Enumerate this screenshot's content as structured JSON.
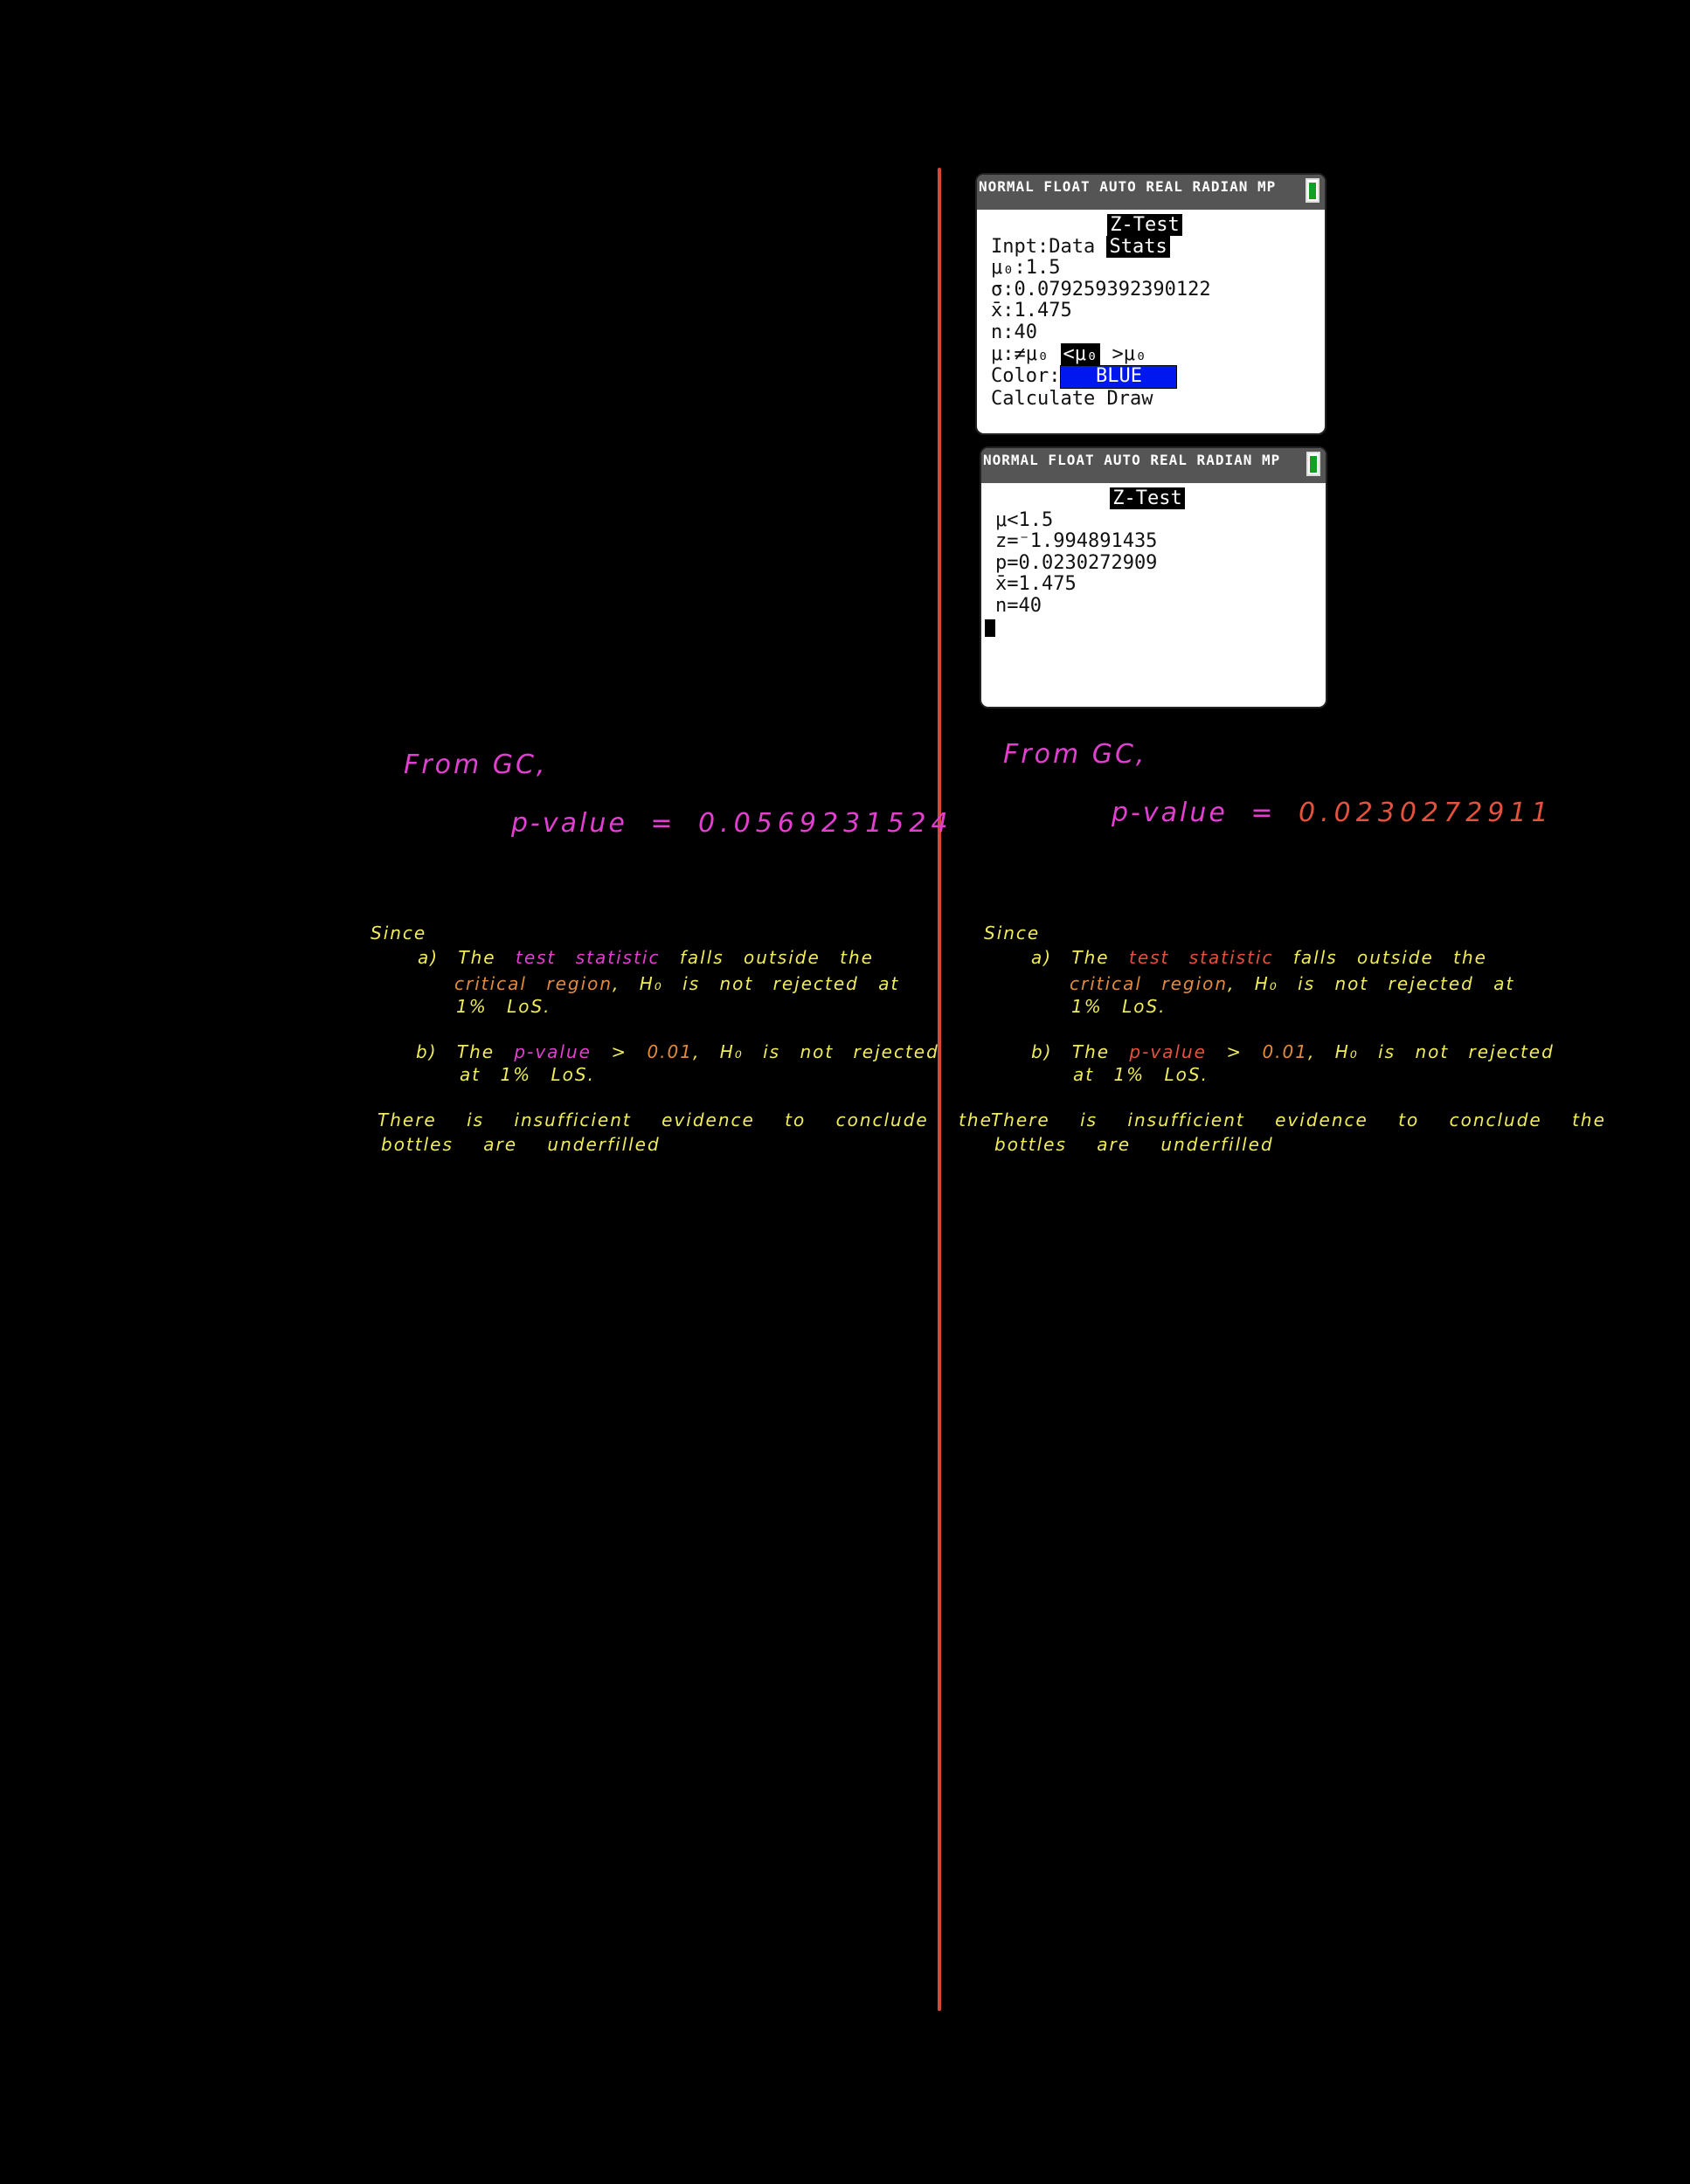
{
  "colors": {
    "divider": "#d64a32",
    "pink": "#e23fd0",
    "yellow": "#f1ec5c",
    "orange": "#e28a3c",
    "red": "#e4513d",
    "calc_blue": "#0018f0",
    "calc_battery": "#13a020"
  },
  "calculator_input": {
    "statusbar": "NORMAL FLOAT AUTO REAL RADIAN MP",
    "battery_icon": "battery-icon",
    "title": "Z-Test",
    "inpt_label": "Inpt:",
    "inpt_option_data": "Data",
    "inpt_option_stats": "Stats",
    "mu0": "μ₀:1.5",
    "sigma": "σ:0.079259392390122",
    "xbar": "x̄:1.475",
    "n": "n:40",
    "mu_label": "μ:",
    "alt_ne": "≠μ₀",
    "alt_lt": "<μ₀",
    "alt_gt": ">μ₀",
    "color_label": "Color:",
    "color_value": "BLUE",
    "calculate": "Calculate",
    "draw": "Draw"
  },
  "calculator_output": {
    "statusbar": "NORMAL FLOAT AUTO REAL RADIAN MP",
    "battery_icon": "battery-icon",
    "title": "Z-Test",
    "hypothesis": "μ<1.5",
    "z": "z=⁻1.994891435",
    "p": "p=0.0230272909",
    "xbar": "x̄=1.475",
    "n": "n=40"
  },
  "left_notes": {
    "from_gc": "From GC,",
    "pvalue_label": "p-value",
    "equals": "=",
    "pvalue": "0.0569231524",
    "since": "Since",
    "a_prefix": "a) The",
    "a_test_statistic": "test statistic",
    "a_falls": "falls outside the",
    "a_critical_region": "critical region",
    "a_rest": ", H₀ is not rejected at",
    "a_los": "1% LoS.",
    "b_prefix": "b) The",
    "b_pvalue": "p-value",
    "b_gt": ">",
    "b_alpha": "0.01",
    "b_rest": ", H₀ is not rejected",
    "b_los": "at 1% LoS.",
    "conclusion_1": "There is insufficient evidence to conclude the",
    "conclusion_2": "bottles are underfilled"
  },
  "right_notes": {
    "from_gc": "From GC,",
    "pvalue_label": "p-value",
    "equals": "=",
    "pvalue": "0.0230272911",
    "since": "Since",
    "a_prefix": "a) The",
    "a_test_statistic": "test statistic",
    "a_falls": "falls outside the",
    "a_critical_region": "critical region",
    "a_rest": ", H₀ is not rejected at",
    "a_los": "1% LoS.",
    "b_prefix": "b) The",
    "b_pvalue": "p-value",
    "b_gt": ">",
    "b_alpha": "0.01",
    "b_rest": ", H₀ is not rejected",
    "b_los": "at 1% LoS.",
    "conclusion_1": "There is insufficient evidence to conclude the",
    "conclusion_2": "bottles are underfilled"
  }
}
